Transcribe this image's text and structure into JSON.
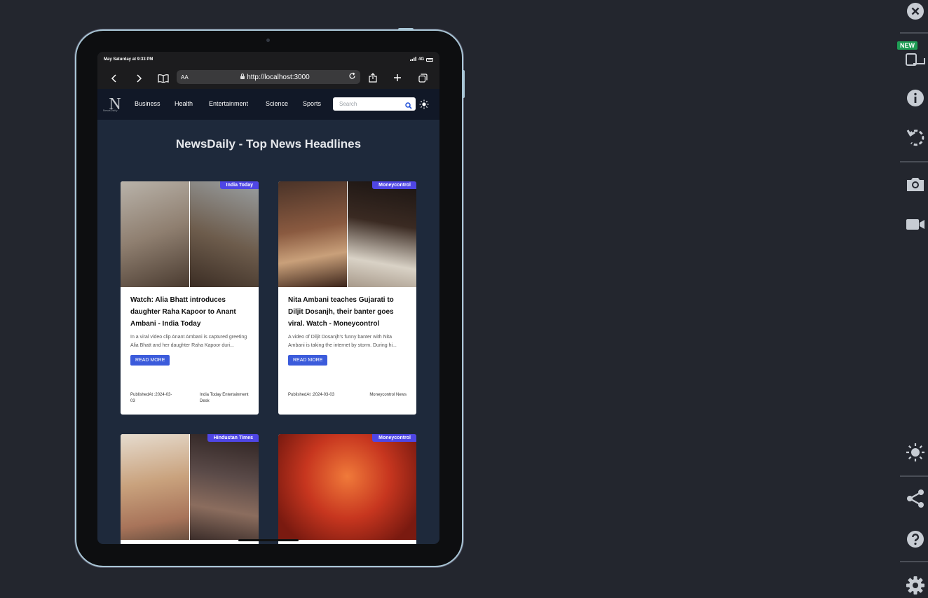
{
  "status_bar": {
    "time": "May Saturday at 9:33 PM",
    "network": "4G"
  },
  "browser": {
    "text_size": "AA",
    "url": "http://localhost:3000"
  },
  "app": {
    "logo_letter": "N",
    "logo_text": "NewsDaily",
    "nav": [
      "Business",
      "Health",
      "Entertainment",
      "Science",
      "Sports"
    ],
    "search_placeholder": "Search",
    "title": "NewsDaily - Top News Headlines"
  },
  "articles": [
    {
      "source": "India Today",
      "title": "Watch: Alia Bhatt introduces daughter Raha Kapoor to Anant Ambani - India Today",
      "description": "In a viral video clip Anant Ambani is captured greeting Alia Bhatt and her daughter Raha Kapoor duri...",
      "cta": "READ MORE",
      "published": "PublishedAt :2024-03-03",
      "author": "India Today Entertainment Desk",
      "colors": [
        "#9a8f83",
        "#6d5c4c"
      ]
    },
    {
      "source": "Moneycontrol",
      "title": "Nita Ambani teaches Gujarati to Diljit Dosanjh, their banter goes viral. Watch - Moneycontrol",
      "description": "A video of Diljit Dosanjh's funny banter with Nita Ambani is taking the internet by storm. During hi...",
      "cta": "READ MORE",
      "published": "PublishedAt :2024-03-03",
      "author": "Moneycontrol News",
      "colors": [
        "#7a4e3a",
        "#3a2a22"
      ]
    },
    {
      "source": "Hindustan Times",
      "title": "",
      "description": "",
      "cta": "",
      "published": "",
      "author": "",
      "colors": [
        "#c9a27d",
        "#5a4a48"
      ]
    },
    {
      "source": "Moneycontrol",
      "title": "",
      "description": "",
      "cta": "",
      "published": "",
      "author": "",
      "colors": [
        "#d2452a",
        "#c24a3f"
      ]
    }
  ],
  "rail": {
    "new_badge": "NEW"
  }
}
